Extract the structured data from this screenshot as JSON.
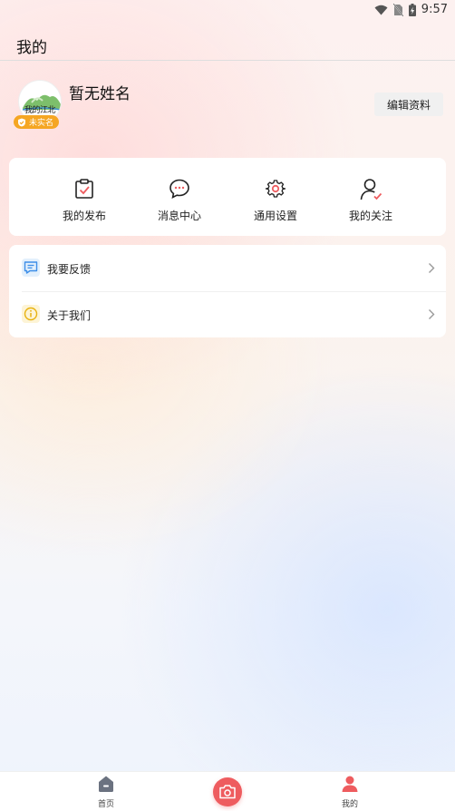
{
  "status_bar": {
    "time": "9:57"
  },
  "header": {
    "title": "我的"
  },
  "profile": {
    "name": "暂无姓名",
    "avatar_text": "我的江北",
    "badge": "未实名",
    "edit_button": "编辑资料"
  },
  "quick_actions": [
    {
      "label": "我的发布",
      "icon": "clipboard-check-icon"
    },
    {
      "label": "消息中心",
      "icon": "chat-bubble-icon"
    },
    {
      "label": "通用设置",
      "icon": "gear-icon"
    },
    {
      "label": "我的关注",
      "icon": "user-check-icon"
    }
  ],
  "menu": [
    {
      "label": "我要反馈",
      "icon": "feedback-icon"
    },
    {
      "label": "关于我们",
      "icon": "info-icon"
    }
  ],
  "tab_bar": {
    "home": "首页",
    "mine": "我的"
  },
  "colors": {
    "accent_red": "#ee5c5f",
    "badge_orange": "#f5a623"
  }
}
